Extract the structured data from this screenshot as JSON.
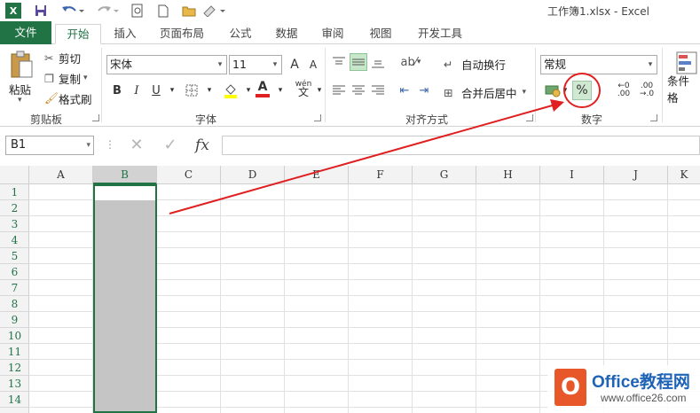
{
  "window": {
    "title": "工作簿1.xlsx - Excel"
  },
  "qat": {
    "app_icon": "X",
    "save_icon": "save-icon",
    "undo_icon": "undo-icon",
    "redo_icon": "redo-icon"
  },
  "tabs": [
    {
      "label": "文件"
    },
    {
      "label": "开始"
    },
    {
      "label": "插入"
    },
    {
      "label": "页面布局"
    },
    {
      "label": "公式"
    },
    {
      "label": "数据"
    },
    {
      "label": "审阅"
    },
    {
      "label": "视图"
    },
    {
      "label": "开发工具"
    }
  ],
  "ribbon": {
    "clipboard": {
      "group": "剪贴板",
      "paste": "粘贴",
      "cut": "剪切",
      "copy": "复制",
      "format_painter": "格式刷"
    },
    "font": {
      "group": "字体",
      "font_name": "宋体",
      "font_size": "11",
      "grow": "A",
      "shrink": "A",
      "bold": "B",
      "italic": "I",
      "underline": "U",
      "phonetic": "wén"
    },
    "alignment": {
      "group": "对齐方式",
      "wrap": "自动换行",
      "merge": "合并后居中"
    },
    "number": {
      "group": "数字",
      "format": "常规",
      "percent": "%"
    },
    "styles": {
      "conditional": "条件格"
    }
  },
  "formula_bar": {
    "name_box": "B1",
    "cancel": "✕",
    "enter": "✓",
    "fx": "fx",
    "formula": ""
  },
  "sheet": {
    "columns": [
      "A",
      "B",
      "C",
      "D",
      "E",
      "F",
      "G",
      "H",
      "I",
      "J",
      "K"
    ],
    "rows": [
      "1",
      "2",
      "3",
      "4",
      "5",
      "6",
      "7",
      "8",
      "9",
      "10",
      "11",
      "12",
      "13",
      "14"
    ],
    "selected_column": "B"
  },
  "annotation": {
    "color": "#e02020"
  },
  "watermark": {
    "name": "Office教程网",
    "url": "www.office26.com"
  },
  "colors": {
    "accent": "#217346"
  }
}
